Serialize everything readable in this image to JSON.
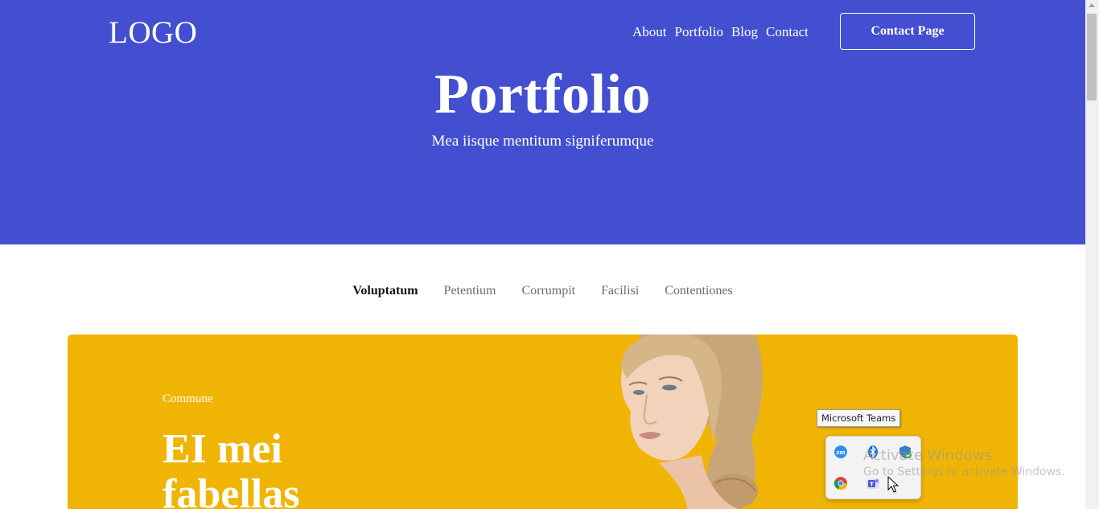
{
  "header": {
    "logo": "LOGO",
    "nav": [
      "About",
      "Portfolio",
      "Blog",
      "Contact"
    ],
    "cta": "Contact Page"
  },
  "hero": {
    "title": "Portfolio",
    "subtitle": "Mea iisque mentitum signiferumque"
  },
  "filters": {
    "items": [
      "Voluptatum",
      "Petentium",
      "Corrumpit",
      "Facilisi",
      "Contentiones"
    ],
    "active": "Voluptatum"
  },
  "card": {
    "category": "Commune",
    "title_line1": "EI mei",
    "title_line2": "fabellas",
    "background": "#f0b504"
  },
  "colors": {
    "hero": "#434fd0",
    "accent": "#f0b504"
  },
  "tray": {
    "tooltip": "Microsoft Teams",
    "icons": [
      "zoom-icon",
      "bluetooth-icon",
      "windows-security-icon",
      "chrome-icon",
      "teams-icon"
    ]
  },
  "watermark": {
    "line1": "Activate Windows",
    "line2": "Go to Settings to activate Windows."
  }
}
